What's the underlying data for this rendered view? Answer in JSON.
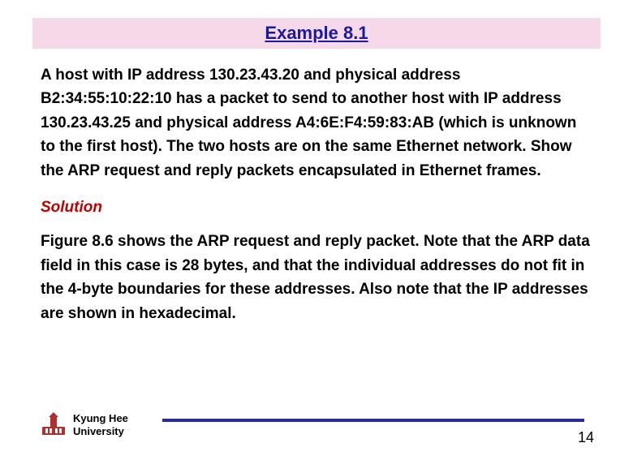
{
  "title": "Example 8.1",
  "problem_text": "A host with IP address 130.23.43.20 and physical address B2:34:55:10:22:10 has a packet to send to another host with IP address 130.23.43.25 and physical address A4:6E:F4:59:83:AB (which is unknown to the first host). The two hosts are on the same Ethernet network. Show the ARP request and reply packets encapsulated in Ethernet frames.",
  "solution_heading": "Solution",
  "solution_text": "Figure 8.6 shows the ARP request and reply packet. Note that the ARP data field in this case is 28 bytes, and that the individual addresses do not fit in the 4-byte boundaries for these addresses. Also note that the IP addresses are shown in hexadecimal.",
  "footer": {
    "university_line1": "Kyung Hee",
    "university_line2": "University",
    "page_number": "14"
  },
  "colors": {
    "title_bg": "#f5d9e8",
    "title_fg": "#1a1a9e",
    "solution_heading": "#c00000",
    "rule": "#2a2aa0"
  }
}
